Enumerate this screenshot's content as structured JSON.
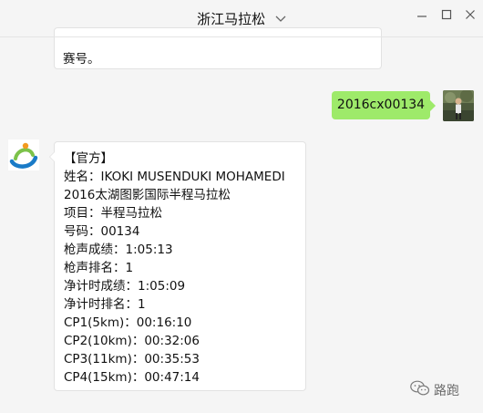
{
  "window": {
    "chat_title": "浙江马拉松"
  },
  "messages": {
    "previous_tail": "赛号。",
    "user_message": "2016cx00134",
    "official_reply": [
      "【官方】",
      "姓名：IKOKI MUSENDUKI MOHAMEDI",
      "2016太湖图影国际半程马拉松",
      "项目：半程马拉松",
      "号码：00134",
      "枪声成绩：1:05:13",
      "枪声排名：1",
      "净计时成绩：1:05:09",
      "净计时排名：1",
      "CP1(5km)：00:16:10",
      "CP2(10km)：00:32:06",
      "CP3(11km)：00:35:53",
      "CP4(15km)：00:47:14"
    ]
  },
  "watermark": {
    "text": "路跑"
  },
  "colors": {
    "background": "#f5f5f5",
    "sent_bubble": "#9eea6a",
    "received_bubble": "#ffffff"
  },
  "icons": [
    "chevron-down-icon",
    "minimize-icon",
    "maximize-icon",
    "close-icon",
    "official-logo-icon",
    "wechat-icon"
  ]
}
